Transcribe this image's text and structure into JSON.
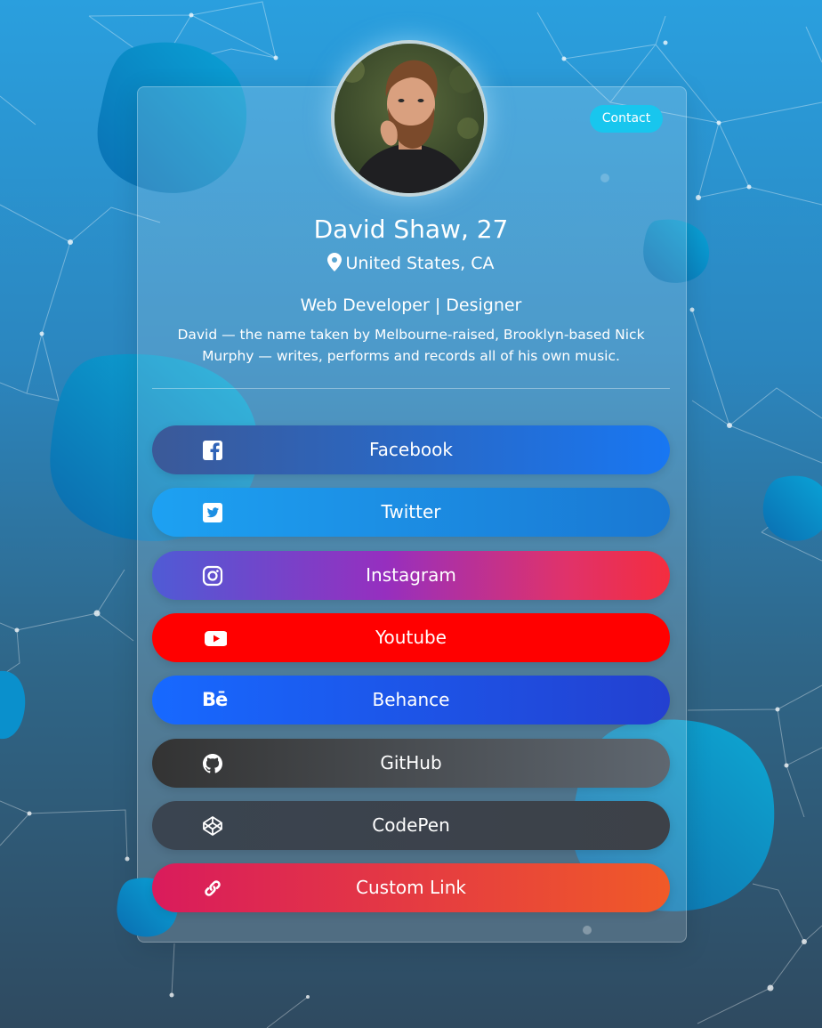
{
  "profile": {
    "name": "David Shaw, 27",
    "location": "United States, CA",
    "role": "Web Developer | Designer",
    "bio": "David — the name taken by Melbourne-raised, Brooklyn-based Nick Murphy — writes, performs and records all of his own music.",
    "avatar_icon": "profile-photo"
  },
  "contact_button": {
    "label": "Contact",
    "color": "#18c6ee"
  },
  "links": [
    {
      "label": "Facebook",
      "icon": "facebook-icon",
      "colors": [
        "#3b5998",
        "#1877f2"
      ]
    },
    {
      "label": "Twitter",
      "icon": "twitter-icon",
      "colors": [
        "#1da1f2",
        "#1a78d3"
      ]
    },
    {
      "label": "Instagram",
      "icon": "instagram-icon",
      "colors": [
        "#4f5bd5",
        "#962fbf",
        "#f42d3f"
      ]
    },
    {
      "label": "Youtube",
      "icon": "youtube-icon",
      "colors": [
        "#ff0000",
        "#ff0000"
      ]
    },
    {
      "label": "Behance",
      "icon": "behance-icon",
      "colors": [
        "#1769ff",
        "#2340d0"
      ]
    },
    {
      "label": "GitHub",
      "icon": "github-icon",
      "colors": [
        "#333333",
        "#5f6770"
      ]
    },
    {
      "label": "CodePen",
      "icon": "codepen-icon",
      "colors": [
        "#3a4450",
        "#3d4148"
      ]
    },
    {
      "label": "Custom Link",
      "icon": "link-icon",
      "colors": [
        "#d91b5c",
        "#f05a28"
      ]
    }
  ]
}
